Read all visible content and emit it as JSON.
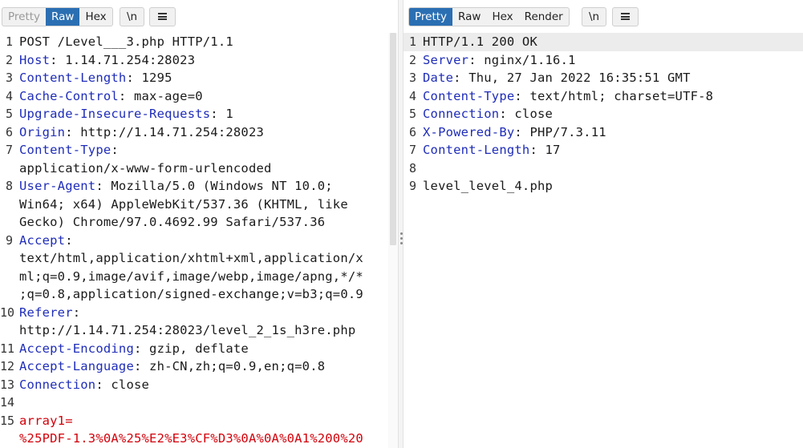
{
  "request": {
    "toolbar": {
      "tabs": [
        "Pretty",
        "Raw",
        "Hex"
      ],
      "active": "Raw",
      "newline_label": "\\n",
      "menu_icon": "menu-icon"
    },
    "lines": [
      {
        "num": "1",
        "rows": [
          [
            {
              "t": "POST /Level___3.php HTTP/1.1"
            }
          ]
        ]
      },
      {
        "num": "2",
        "rows": [
          [
            {
              "t": "Host",
              "c": "k"
            },
            {
              "t": ": 1.14.71.254:28023"
            }
          ]
        ]
      },
      {
        "num": "3",
        "rows": [
          [
            {
              "t": "Content-Length",
              "c": "k"
            },
            {
              "t": ": 1295"
            }
          ]
        ]
      },
      {
        "num": "4",
        "rows": [
          [
            {
              "t": "Cache-Control",
              "c": "k"
            },
            {
              "t": ": max-age=0"
            }
          ]
        ]
      },
      {
        "num": "5",
        "rows": [
          [
            {
              "t": "Upgrade-Insecure-Requests",
              "c": "k"
            },
            {
              "t": ": 1"
            }
          ]
        ]
      },
      {
        "num": "6",
        "rows": [
          [
            {
              "t": "Origin",
              "c": "k"
            },
            {
              "t": ": http://1.14.71.254:28023"
            }
          ]
        ]
      },
      {
        "num": "7",
        "rows": [
          [
            {
              "t": "Content-Type",
              "c": "k"
            },
            {
              "t": ":"
            }
          ],
          [
            {
              "t": "application/x-www-form-urlencoded"
            }
          ]
        ]
      },
      {
        "num": "8",
        "rows": [
          [
            {
              "t": "User-Agent",
              "c": "k"
            },
            {
              "t": ": Mozilla/5.0 (Windows NT 10.0;"
            }
          ],
          [
            {
              "t": "Win64; x64) AppleWebKit/537.36 (KHTML, like"
            }
          ],
          [
            {
              "t": "Gecko) Chrome/97.0.4692.99 Safari/537.36"
            }
          ]
        ]
      },
      {
        "num": "9",
        "rows": [
          [
            {
              "t": "Accept",
              "c": "k"
            },
            {
              "t": ":"
            }
          ],
          [
            {
              "t": "text/html,application/xhtml+xml,application/x"
            }
          ],
          [
            {
              "t": "ml;q=0.9,image/avif,image/webp,image/apng,*/*"
            }
          ],
          [
            {
              "t": ";q=0.8,application/signed-exchange;v=b3;q=0.9"
            }
          ]
        ]
      },
      {
        "num": "10",
        "rows": [
          [
            {
              "t": "Referer",
              "c": "k"
            },
            {
              "t": ":"
            }
          ],
          [
            {
              "t": "http://1.14.71.254:28023/level_2_1s_h3re.php"
            }
          ]
        ]
      },
      {
        "num": "11",
        "rows": [
          [
            {
              "t": "Accept-Encoding",
              "c": "k"
            },
            {
              "t": ": gzip, deflate"
            }
          ]
        ]
      },
      {
        "num": "12",
        "rows": [
          [
            {
              "t": "Accept-Language",
              "c": "k"
            },
            {
              "t": ": zh-CN,zh;q=0.9,en;q=0.8"
            }
          ]
        ]
      },
      {
        "num": "13",
        "rows": [
          [
            {
              "t": "Connection",
              "c": "k"
            },
            {
              "t": ": close"
            }
          ]
        ]
      },
      {
        "num": "14",
        "rows": [
          [
            {
              "t": ""
            }
          ]
        ]
      },
      {
        "num": "15",
        "rows": [
          [
            {
              "t": "array1=",
              "c": "red"
            }
          ],
          [
            {
              "t": "%25PDF-1.3%0A%25%E2%E3%CF%D3%0A%0A%0A1%200%20",
              "c": "red"
            }
          ]
        ]
      }
    ]
  },
  "response": {
    "toolbar": {
      "tabs": [
        "Pretty",
        "Raw",
        "Hex",
        "Render"
      ],
      "active": "Pretty",
      "newline_label": "\\n",
      "menu_icon": "menu-icon"
    },
    "lines": [
      {
        "num": "1",
        "highlight": true,
        "rows": [
          [
            {
              "t": "HTTP/1.1 200 OK"
            }
          ]
        ]
      },
      {
        "num": "2",
        "rows": [
          [
            {
              "t": "Server",
              "c": "k"
            },
            {
              "t": ": nginx/1.16.1"
            }
          ]
        ]
      },
      {
        "num": "3",
        "rows": [
          [
            {
              "t": "Date",
              "c": "k"
            },
            {
              "t": ": Thu, 27 Jan 2022 16:35:51 GMT"
            }
          ]
        ]
      },
      {
        "num": "4",
        "rows": [
          [
            {
              "t": "Content-Type",
              "c": "k"
            },
            {
              "t": ": text/html; charset=UTF-8"
            }
          ]
        ]
      },
      {
        "num": "5",
        "rows": [
          [
            {
              "t": "Connection",
              "c": "k"
            },
            {
              "t": ": close"
            }
          ]
        ]
      },
      {
        "num": "6",
        "rows": [
          [
            {
              "t": "X-Powered-By",
              "c": "k"
            },
            {
              "t": ": PHP/7.3.11"
            }
          ]
        ]
      },
      {
        "num": "7",
        "rows": [
          [
            {
              "t": "Content-Length",
              "c": "k"
            },
            {
              "t": ": 17"
            }
          ]
        ]
      },
      {
        "num": "8",
        "rows": [
          [
            {
              "t": ""
            }
          ]
        ]
      },
      {
        "num": "9",
        "rows": [
          [
            {
              "t": "level_level_4.php"
            }
          ]
        ]
      }
    ]
  }
}
